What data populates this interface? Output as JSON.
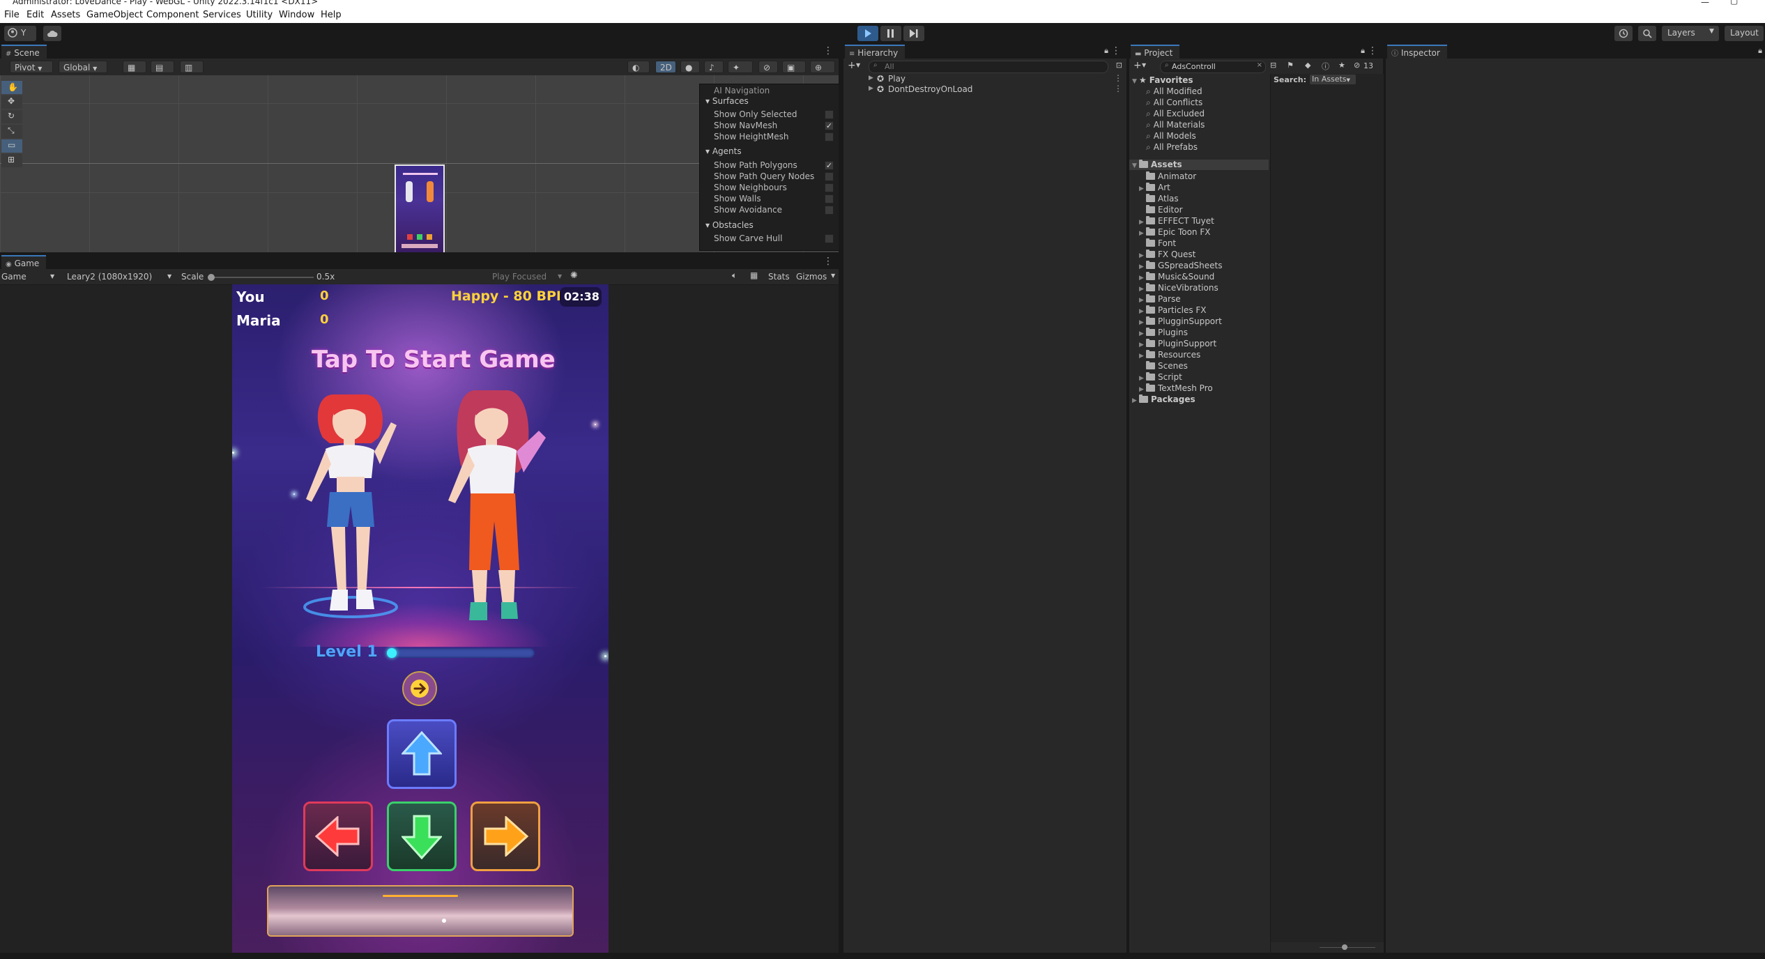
{
  "window": {
    "title": "Administrator: LoveDance - Play - WebGL - Unity 2022.3.14f1c1 <DX11>"
  },
  "menu": [
    "File",
    "Edit",
    "Assets",
    "GameObject",
    "Component",
    "Services",
    "Utility",
    "Window",
    "Help"
  ],
  "toolbar": {
    "account_label": "Y",
    "layers_label": "Layers",
    "layout_label": "Layout"
  },
  "scene": {
    "tab_label": "Scene",
    "pivot_label": "Pivot",
    "global_label": "Global",
    "mode_2d_label": "2D"
  },
  "ai_navigation": {
    "title": "AI Navigation",
    "sections": [
      {
        "label": "Surfaces",
        "items": [
          {
            "label": "Show Only Selected",
            "checked": false
          },
          {
            "label": "Show NavMesh",
            "checked": true
          },
          {
            "label": "Show HeightMesh",
            "checked": false
          }
        ]
      },
      {
        "label": "Agents",
        "items": [
          {
            "label": "Show Path Polygons",
            "checked": true
          },
          {
            "label": "Show Path Query Nodes",
            "checked": false
          },
          {
            "label": "Show Neighbours",
            "checked": false
          },
          {
            "label": "Show Walls",
            "checked": false
          },
          {
            "label": "Show Avoidance",
            "checked": false
          }
        ]
      },
      {
        "label": "Obstacles",
        "items": [
          {
            "label": "Show Carve Hull",
            "checked": false
          }
        ]
      }
    ]
  },
  "game": {
    "tab_label": "Game",
    "display_label": "Game",
    "resolution_label": "Leary2 (1080x1920)",
    "scale_label": "Scale",
    "scale_value": "0.5x",
    "scale_fraction": 0.02,
    "play_focused_label": "Play Focused",
    "stats_label": "Stats",
    "gizmos_label": "Gizmos",
    "hud": {
      "player1_name": "You",
      "player1_score": "0",
      "player2_name": "Maria",
      "player2_score": "0",
      "song_label": "Happy - 80 BPI",
      "timer": "02:38",
      "start_prompt": "Tap To Start Game",
      "level_label": "Level 1",
      "level_progress": 0.02
    }
  },
  "hierarchy": {
    "tab_label": "Hierarchy",
    "search_placeholder": "All",
    "items": [
      "Play",
      "DontDestroyOnLoad"
    ]
  },
  "project": {
    "tab_label": "Project",
    "search_value": "AdsControll",
    "hidden_count": "13",
    "search_scope_label": "Search:",
    "search_scope_value": "In Assets",
    "favorites_label": "Favorites",
    "favorites": [
      "All Modified",
      "All Conflicts",
      "All Excluded",
      "All Materials",
      "All Models",
      "All Prefabs"
    ],
    "assets_label": "Assets",
    "folders": [
      {
        "name": "Animator",
        "expandable": false
      },
      {
        "name": "Art",
        "expandable": true
      },
      {
        "name": "Atlas",
        "expandable": false
      },
      {
        "name": "Editor",
        "expandable": false
      },
      {
        "name": "EFFECT Tuyet",
        "expandable": true
      },
      {
        "name": "Epic Toon FX",
        "expandable": true
      },
      {
        "name": "Font",
        "expandable": false
      },
      {
        "name": "FX Quest",
        "expandable": true
      },
      {
        "name": "GSpreadSheets",
        "expandable": true
      },
      {
        "name": "Music&Sound",
        "expandable": true
      },
      {
        "name": "NiceVibrations",
        "expandable": true
      },
      {
        "name": "Parse",
        "expandable": true
      },
      {
        "name": "Particles FX",
        "expandable": true
      },
      {
        "name": "PlugginSupport",
        "expandable": true
      },
      {
        "name": "Plugins",
        "expandable": true
      },
      {
        "name": "PluginSupport",
        "expandable": true
      },
      {
        "name": "Resources",
        "expandable": true
      },
      {
        "name": "Scenes",
        "expandable": false
      },
      {
        "name": "Script",
        "expandable": true
      },
      {
        "name": "TextMesh Pro",
        "expandable": true
      }
    ],
    "packages_label": "Packages"
  },
  "inspector": {
    "tab_label": "Inspector"
  },
  "colors": {
    "accent": "#3a79bb",
    "play_active": "#2e5a8c",
    "hud_yellow": "#ffd23a",
    "title_pink": "#f7c6f0",
    "level_blue": "#4fa6ff"
  }
}
